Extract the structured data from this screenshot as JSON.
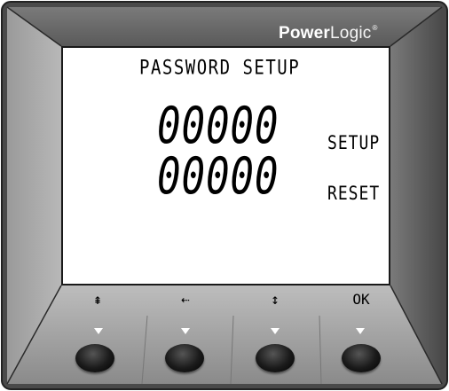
{
  "device": {
    "brand_bold": "Power",
    "brand_light": "Logic",
    "brand_mark": "®"
  },
  "screen": {
    "title": "PASSWORD SETUP",
    "rows": [
      {
        "value": "00000",
        "label": "SETUP"
      },
      {
        "value": "00000",
        "label": "RESET"
      }
    ]
  },
  "softkeys": [
    {
      "label": "⇞",
      "icon": "up-to-top-icon"
    },
    {
      "label": "⇠",
      "icon": "back-arrow-icon"
    },
    {
      "label": "↕",
      "icon": "plus-minus-icon"
    },
    {
      "label": "OK",
      "icon": "ok-icon"
    }
  ],
  "colors": {
    "bezel_outer": "#5a5a5a",
    "bezel_light": "#a0a0a0",
    "bezel_dark": "#3a3a3a",
    "screen_bg": "#ffffff",
    "button": "#111111"
  }
}
